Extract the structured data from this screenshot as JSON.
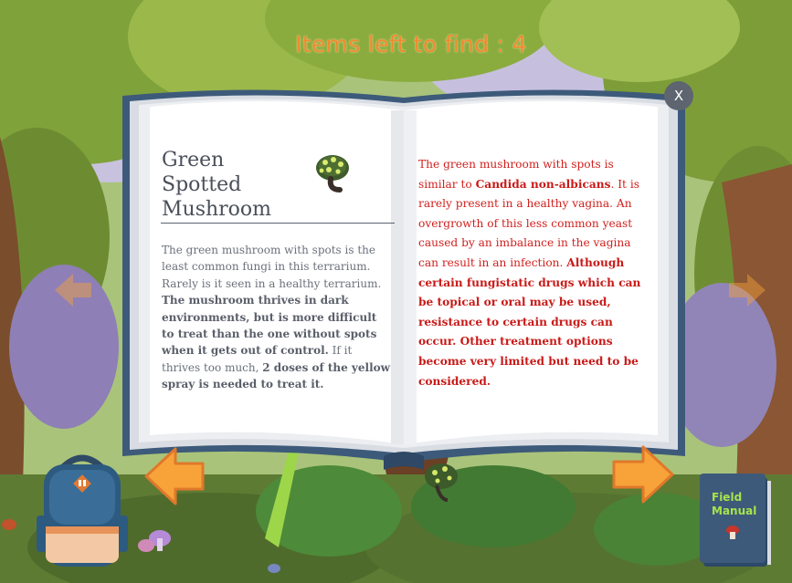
{
  "hud": {
    "items_left": "Items left to find : 4"
  },
  "book": {
    "close_label": "X",
    "entry": {
      "title_line1": "Green Spotted",
      "title_line2": "Mushroom",
      "left_plain_1": "The green mushroom with spots is the least common fungi in this terrarium. Rarely is it seen in a healthy terrarium. ",
      "left_bold_1": "The mushroom thrives in dark environments, but is more difficult to treat than the one without spots when it gets out of control.",
      "left_plain_2": " If it thrives too much, ",
      "left_bold_2": "2 doses of the yellow spray is needed to treat it.",
      "right_plain_1": "The green mushroom with spots is similar to ",
      "right_bold_1": "Candida non-albicans",
      "right_plain_2": ". It is rarely present in a healthy vagina. An overgrowth of this less common yeast caused by an imbalance in the vagina can result in an infection. ",
      "right_bold_2": "Although certain fungistatic drugs which can be topical or oral may be used, resistance to certain drugs can occur. Other treatment options become very limited but need to be considered."
    }
  },
  "field_manual": {
    "label_line1": "Field",
    "label_line2": "Manual"
  },
  "colors": {
    "hud_text": "#f28a2e",
    "right_page_text": "#d0201e",
    "arrow": "#f7a33a",
    "manual_cover": "#3d5a7a",
    "manual_label": "#a6e44b"
  },
  "icons": {
    "close": "close-icon",
    "prev": "left-arrow-icon",
    "next": "right-arrow-icon",
    "backpack": "backpack-icon",
    "manual": "book-icon",
    "entry": "green-spotted-mushroom-icon"
  }
}
